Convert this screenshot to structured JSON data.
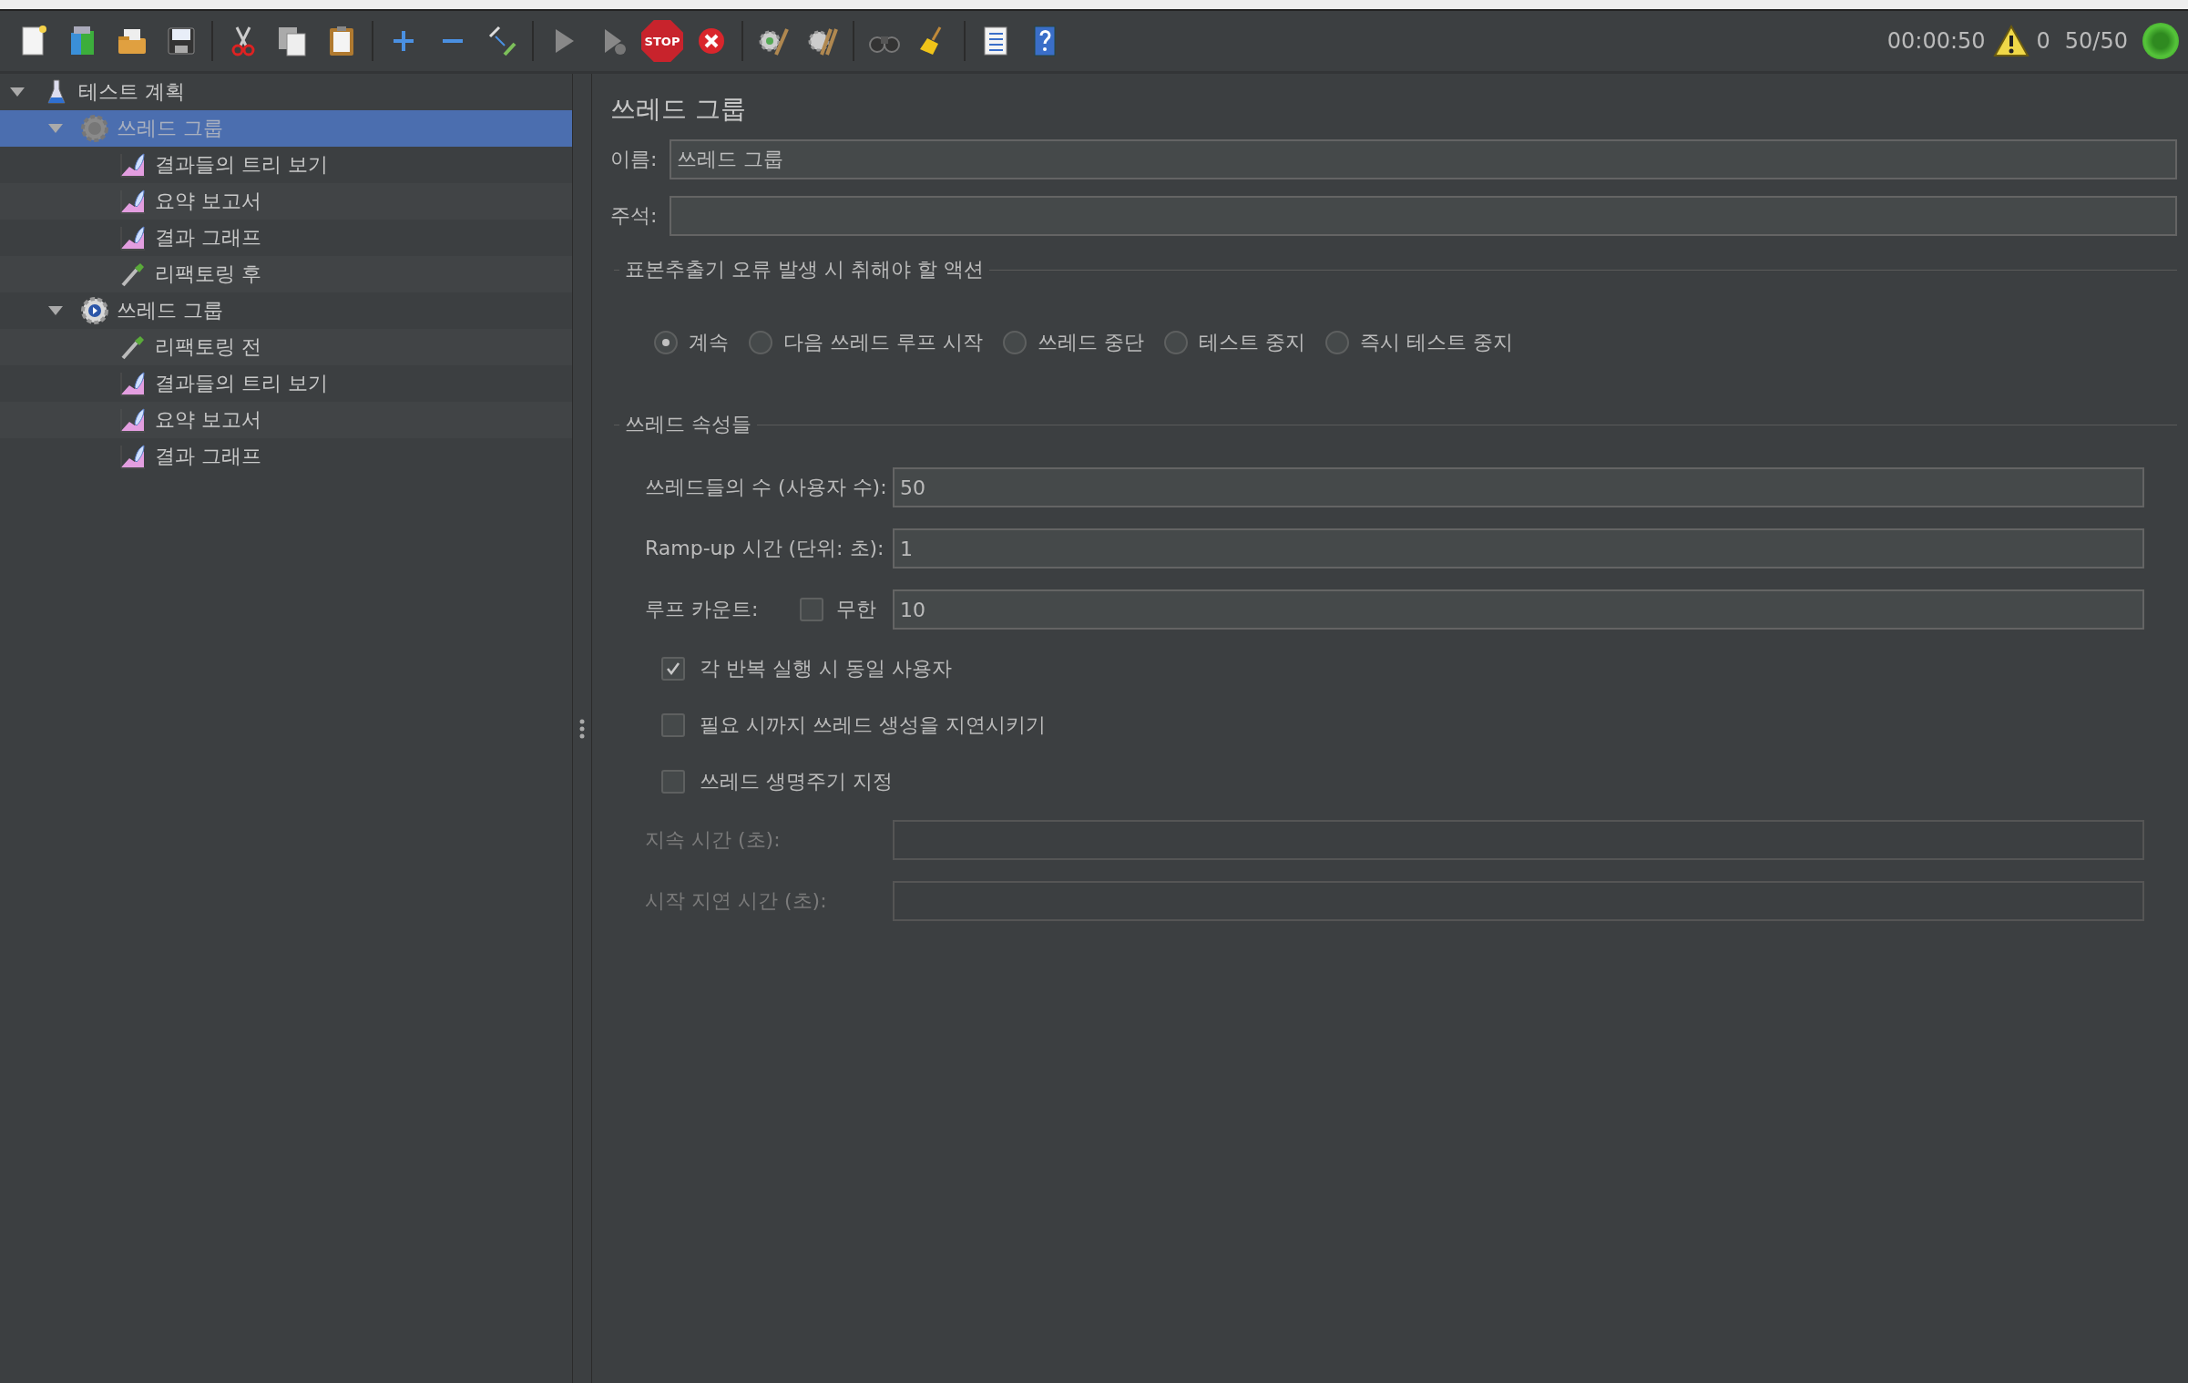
{
  "toolbar": {
    "stop_label": "STOP"
  },
  "status": {
    "timer": "00:00:50",
    "warnings": "0",
    "threads": "50/50",
    "running": true
  },
  "tree": [
    {
      "label": "테스트 계획",
      "kind": "plan",
      "selected": false,
      "disabled": false,
      "expanded": true,
      "children": [
        {
          "label": "쓰레드 그룹",
          "kind": "thread_group",
          "selected": true,
          "disabled": true,
          "expanded": true,
          "children": [
            {
              "label": "결과들의 트리 보기",
              "kind": "listener",
              "selected": false,
              "disabled": false
            },
            {
              "label": "요약 보고서",
              "kind": "listener",
              "selected": false,
              "disabled": false
            },
            {
              "label": "결과 그래프",
              "kind": "listener",
              "selected": false,
              "disabled": false
            },
            {
              "label": "리팩토링 후",
              "kind": "extractor",
              "selected": false,
              "disabled": false
            }
          ]
        },
        {
          "label": "쓰레드 그룹",
          "kind": "thread_group",
          "selected": false,
          "disabled": false,
          "expanded": true,
          "children": [
            {
              "label": "리팩토링 전",
              "kind": "extractor",
              "selected": false,
              "disabled": false
            },
            {
              "label": "결과들의 트리 보기",
              "kind": "listener",
              "selected": false,
              "disabled": false
            },
            {
              "label": "요약 보고서",
              "kind": "listener",
              "selected": false,
              "disabled": false
            },
            {
              "label": "결과 그래프",
              "kind": "listener",
              "selected": false,
              "disabled": false
            }
          ]
        }
      ]
    }
  ],
  "form": {
    "title": "쓰레드 그룹",
    "name": {
      "label": "이름:",
      "value": "쓰레드 그룹"
    },
    "comments": {
      "label": "주석:"
    },
    "error_action": {
      "legend": "표본추출기 오류 발생 시 취해야 할 액션",
      "options": [
        {
          "label": "계속",
          "selected": true
        },
        {
          "label": "다음 쓰레드 루프 시작",
          "selected": false
        },
        {
          "label": "쓰레드 중단",
          "selected": false
        },
        {
          "label": "테스트 중지",
          "selected": false
        },
        {
          "label": "즉시 테스트 중지",
          "selected": false
        }
      ]
    },
    "thread_properties": {
      "legend": "쓰레드 속성들",
      "rows": [
        {
          "kind": "field",
          "label": "쓰레드들의 수 (사용자 수):",
          "value": "50",
          "disabled": false
        },
        {
          "kind": "field",
          "label": "Ramp-up 시간 (단위: 초):",
          "value": "1",
          "disabled": false
        },
        {
          "kind": "loop",
          "label": "루프 카운트:",
          "option": "무한",
          "checked": false,
          "value": "10",
          "disabled": false
        },
        {
          "kind": "checkbox",
          "label": "각 반복 실행 시 동일 사용자",
          "checked": true,
          "disabled": false
        },
        {
          "kind": "checkbox",
          "label": "필요 시까지 쓰레드 생성을 지연시키기",
          "checked": false,
          "disabled": false
        },
        {
          "kind": "checkbox",
          "label": "쓰레드 생명주기 지정",
          "checked": false,
          "disabled": false
        },
        {
          "kind": "field",
          "label": "지속 시간 (초):",
          "disabled": true
        },
        {
          "kind": "field",
          "label": "시작 지연 시간 (초):",
          "disabled": true
        }
      ]
    }
  }
}
